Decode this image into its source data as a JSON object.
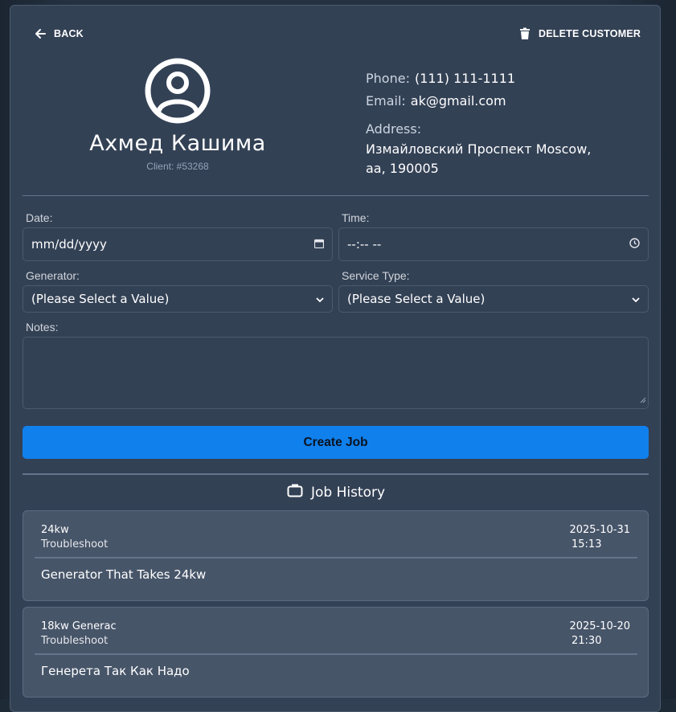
{
  "nav": {
    "back_label": "BACK",
    "delete_label": "DELETE CUSTOMER"
  },
  "customer": {
    "name": "Ахмед Кашима",
    "client_id": "Client: #53268",
    "phone_label": "Phone:",
    "phone": "(111) 111-1111",
    "email_label": "Email:",
    "email": "ak@gmail.com",
    "address_label": "Address:",
    "address_line1": "Измайловский Проспект Moscow,",
    "address_line2": "aa, 190005"
  },
  "form": {
    "date_label": "Date:",
    "date_value": "mm/dd/yyyy",
    "time_label": "Time:",
    "time_value": "--:-- --",
    "generator_label": "Generator:",
    "generator_value": "(Please Select a Value)",
    "service_type_label": "Service Type:",
    "service_type_value": "(Please Select a Value)",
    "notes_label": "Notes:",
    "notes_value": "",
    "create_button": "Create Job"
  },
  "history": {
    "title": "Job History",
    "jobs": [
      {
        "generator": "24kw",
        "service": "Troubleshoot",
        "date": "2025-10-31",
        "time": "15:13",
        "note": "Generator That Takes 24kw"
      },
      {
        "generator": "18kw Generac",
        "service": "Troubleshoot",
        "date": "2025-10-20",
        "time": "21:30",
        "note": "Генерета Так Как Надо"
      }
    ]
  },
  "colors": {
    "card_bg": "#334155",
    "job_card_bg": "#475569",
    "primary_button": "#1080ec"
  }
}
